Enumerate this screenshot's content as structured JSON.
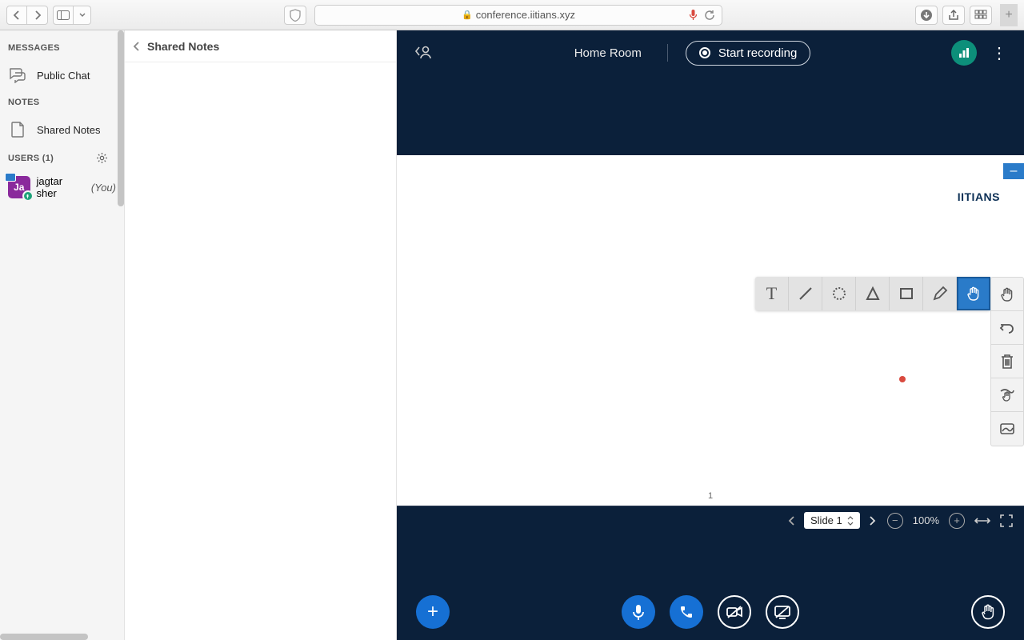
{
  "browser": {
    "url": "conference.iitians.xyz"
  },
  "sidebar": {
    "messages_label": "MESSAGES",
    "public_chat": "Public Chat",
    "notes_label": "NOTES",
    "shared_notes": "Shared Notes",
    "users_label": "USERS (1)",
    "user": {
      "initials": "Ja",
      "name": "jagtar sher",
      "you": "(You)"
    }
  },
  "notes_panel": {
    "title": "Shared Notes"
  },
  "conference": {
    "room_name": "Home Room",
    "record_label": "Start recording",
    "brand": "IITIANS",
    "page_number": "1",
    "slide_label": "Slide 1",
    "zoom": "100%"
  }
}
